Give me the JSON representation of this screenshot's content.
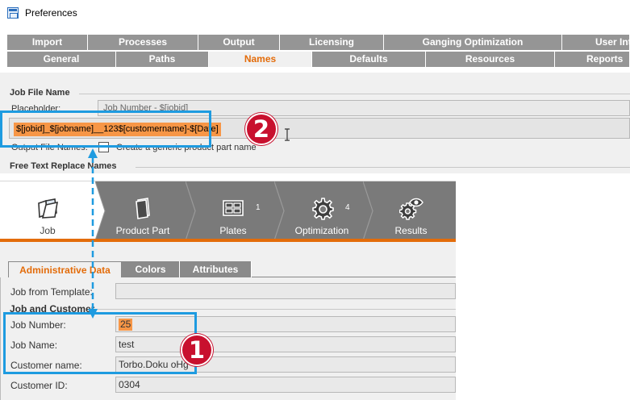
{
  "window": {
    "title": "Preferences"
  },
  "pref_tabs_row1": [
    {
      "label": "Import"
    },
    {
      "label": "Processes"
    },
    {
      "label": "Output"
    },
    {
      "label": "Licensing"
    },
    {
      "label": "Ganging Optimization"
    },
    {
      "label": "User Int"
    }
  ],
  "pref_tabs_row2": [
    {
      "label": "General"
    },
    {
      "label": "Paths"
    },
    {
      "label": "Names",
      "active": true
    },
    {
      "label": "Defaults"
    },
    {
      "label": "Resources"
    },
    {
      "label": "Reports"
    }
  ],
  "job_file_name": {
    "section_title": "Job File Name",
    "placeholder_label": "Placeholder:",
    "placeholder_value": "Job Number - $[jobid]",
    "names_input_value": "$[jobid]_$[jobname]__123$[customername]-$[Date]",
    "output_file_names_label": "Output File Names:",
    "checkbox_label": "Create a generic product part name"
  },
  "free_text": {
    "section_title": "Free Text Replace Names"
  },
  "steps": [
    {
      "label": "Job",
      "icon": "folder-icon",
      "active": true
    },
    {
      "label": "Product Part",
      "icon": "document-icon"
    },
    {
      "label": "Plates",
      "icon": "plates-icon",
      "count": "1"
    },
    {
      "label": "Optimization",
      "icon": "gear-icon",
      "count": "4"
    },
    {
      "label": "Results",
      "icon": "results-icon"
    }
  ],
  "job_tabs": [
    {
      "label": "Administrative Data",
      "active": true
    },
    {
      "label": "Colors"
    },
    {
      "label": "Attributes"
    }
  ],
  "job_form": {
    "job_from_template_label": "Job from Template:",
    "job_from_template_value": "",
    "section_title": "Job and Customer",
    "job_number_label": "Job Number:",
    "job_number_value": "25",
    "job_name_label": "Job Name:",
    "job_name_value": "test",
    "customer_name_label": "Customer name:",
    "customer_name_value": "Torbo.Doku oHg",
    "customer_id_label": "Customer ID:",
    "customer_id_value": "0304"
  },
  "annotations": {
    "badge_1": "1",
    "badge_2": "2"
  },
  "colors": {
    "accent": "#e36c0a",
    "highlight": "#1e9be0",
    "badge": "#c8102e",
    "value_fill": "#f79646"
  }
}
